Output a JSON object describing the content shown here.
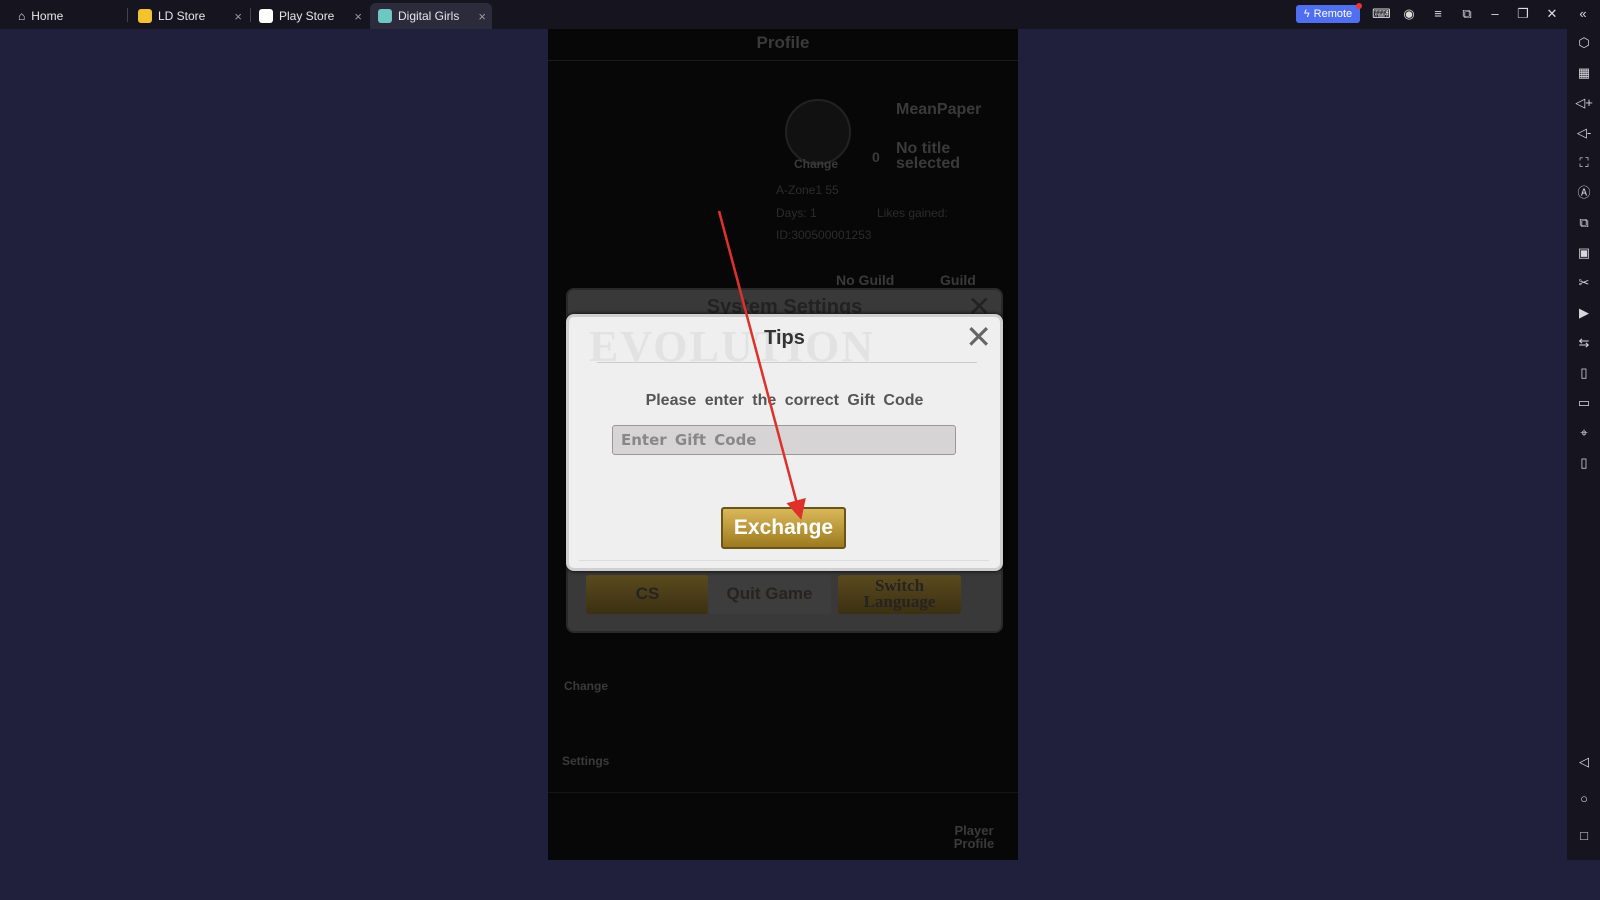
{
  "tabs": [
    {
      "label": "Home",
      "icon": "home-icon"
    },
    {
      "label": "LD Store",
      "icon": "gamepad-icon"
    },
    {
      "label": "Play Store",
      "icon": "play-store-icon"
    },
    {
      "label": "Digital Girls",
      "icon": "app-icon",
      "active": true
    }
  ],
  "titlebar": {
    "remote_label": "Remote",
    "close_glyph": "×"
  },
  "game": {
    "header": "Profile",
    "player": {
      "name": "MeanPaper",
      "avatar_label": "Change",
      "title": "No title selected",
      "title_level": "0",
      "zone": "A-Zone1 55",
      "days": "Days: 1",
      "likes": "Likes gained:",
      "id": "ID:300500001253",
      "guild": "No Guild",
      "guild_btn": "Guild"
    },
    "side_buttons": {
      "change": "Change",
      "settings": "Settings",
      "player_profile": "Player Profile"
    },
    "system_settings": {
      "title": "System Settings",
      "watermark": "EVOLUTION",
      "buttons": [
        "CS",
        "Quit Game",
        "Switch Language"
      ]
    },
    "tips": {
      "title": "Tips",
      "message": "Please enter the correct Gift Code",
      "input_placeholder": "Enter Gift Code",
      "input_value": "",
      "button": "Exchange"
    }
  },
  "colors": {
    "accent": "#4f6ff0",
    "gold": "#c9a640",
    "annotation_arrow": "#e0302a"
  }
}
